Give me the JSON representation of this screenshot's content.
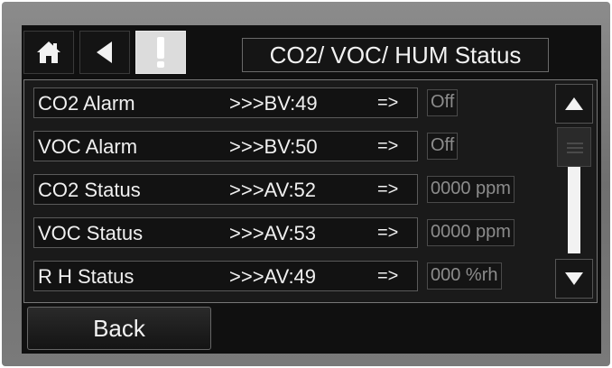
{
  "header": {
    "title": "CO2/  VOC/ HUM Status",
    "home_icon": "home-icon",
    "back_icon": "left-triangle-icon",
    "alert_icon": "exclamation-icon"
  },
  "rows": [
    {
      "name": "CO2  Alarm",
      "ref": ">>>BV:49",
      "arrow": "=>",
      "value": "Off"
    },
    {
      "name": "VOC Alarm",
      "ref": ">>>BV:50",
      "arrow": "=>",
      "value": "Off"
    },
    {
      "name": "CO2  Status",
      "ref": ">>>AV:52",
      "arrow": "=>",
      "value": "0000 ppm"
    },
    {
      "name": "VOC Status",
      "ref": ">>>AV:53",
      "arrow": "=>",
      "value": "0000 ppm"
    },
    {
      "name": "R H Status",
      "ref": ">>>AV:49",
      "arrow": "=>",
      "value": "000 %rh"
    }
  ],
  "scrollbar": {
    "up_icon": "triangle-up-icon",
    "down_icon": "triangle-down-icon"
  },
  "footer": {
    "back_label": "Back"
  },
  "colors": {
    "screen_bg": "#101010",
    "bezel": "#7a7a7a",
    "warn_button": "#dcdcdc"
  }
}
